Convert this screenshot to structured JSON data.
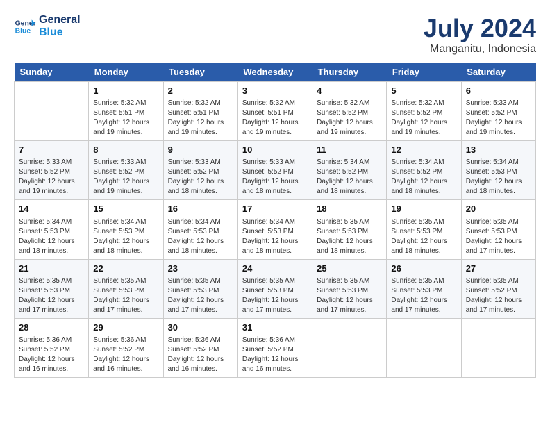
{
  "header": {
    "logo_line1": "General",
    "logo_line2": "Blue",
    "month_year": "July 2024",
    "location": "Manganitu, Indonesia"
  },
  "weekdays": [
    "Sunday",
    "Monday",
    "Tuesday",
    "Wednesday",
    "Thursday",
    "Friday",
    "Saturday"
  ],
  "weeks": [
    [
      {
        "date": "",
        "sunrise": "",
        "sunset": "",
        "daylight": ""
      },
      {
        "date": "1",
        "sunrise": "Sunrise: 5:32 AM",
        "sunset": "Sunset: 5:51 PM",
        "daylight": "Daylight: 12 hours and 19 minutes."
      },
      {
        "date": "2",
        "sunrise": "Sunrise: 5:32 AM",
        "sunset": "Sunset: 5:51 PM",
        "daylight": "Daylight: 12 hours and 19 minutes."
      },
      {
        "date": "3",
        "sunrise": "Sunrise: 5:32 AM",
        "sunset": "Sunset: 5:51 PM",
        "daylight": "Daylight: 12 hours and 19 minutes."
      },
      {
        "date": "4",
        "sunrise": "Sunrise: 5:32 AM",
        "sunset": "Sunset: 5:52 PM",
        "daylight": "Daylight: 12 hours and 19 minutes."
      },
      {
        "date": "5",
        "sunrise": "Sunrise: 5:32 AM",
        "sunset": "Sunset: 5:52 PM",
        "daylight": "Daylight: 12 hours and 19 minutes."
      },
      {
        "date": "6",
        "sunrise": "Sunrise: 5:33 AM",
        "sunset": "Sunset: 5:52 PM",
        "daylight": "Daylight: 12 hours and 19 minutes."
      }
    ],
    [
      {
        "date": "7",
        "sunrise": "Sunrise: 5:33 AM",
        "sunset": "Sunset: 5:52 PM",
        "daylight": "Daylight: 12 hours and 19 minutes."
      },
      {
        "date": "8",
        "sunrise": "Sunrise: 5:33 AM",
        "sunset": "Sunset: 5:52 PM",
        "daylight": "Daylight: 12 hours and 19 minutes."
      },
      {
        "date": "9",
        "sunrise": "Sunrise: 5:33 AM",
        "sunset": "Sunset: 5:52 PM",
        "daylight": "Daylight: 12 hours and 18 minutes."
      },
      {
        "date": "10",
        "sunrise": "Sunrise: 5:33 AM",
        "sunset": "Sunset: 5:52 PM",
        "daylight": "Daylight: 12 hours and 18 minutes."
      },
      {
        "date": "11",
        "sunrise": "Sunrise: 5:34 AM",
        "sunset": "Sunset: 5:52 PM",
        "daylight": "Daylight: 12 hours and 18 minutes."
      },
      {
        "date": "12",
        "sunrise": "Sunrise: 5:34 AM",
        "sunset": "Sunset: 5:52 PM",
        "daylight": "Daylight: 12 hours and 18 minutes."
      },
      {
        "date": "13",
        "sunrise": "Sunrise: 5:34 AM",
        "sunset": "Sunset: 5:53 PM",
        "daylight": "Daylight: 12 hours and 18 minutes."
      }
    ],
    [
      {
        "date": "14",
        "sunrise": "Sunrise: 5:34 AM",
        "sunset": "Sunset: 5:53 PM",
        "daylight": "Daylight: 12 hours and 18 minutes."
      },
      {
        "date": "15",
        "sunrise": "Sunrise: 5:34 AM",
        "sunset": "Sunset: 5:53 PM",
        "daylight": "Daylight: 12 hours and 18 minutes."
      },
      {
        "date": "16",
        "sunrise": "Sunrise: 5:34 AM",
        "sunset": "Sunset: 5:53 PM",
        "daylight": "Daylight: 12 hours and 18 minutes."
      },
      {
        "date": "17",
        "sunrise": "Sunrise: 5:34 AM",
        "sunset": "Sunset: 5:53 PM",
        "daylight": "Daylight: 12 hours and 18 minutes."
      },
      {
        "date": "18",
        "sunrise": "Sunrise: 5:35 AM",
        "sunset": "Sunset: 5:53 PM",
        "daylight": "Daylight: 12 hours and 18 minutes."
      },
      {
        "date": "19",
        "sunrise": "Sunrise: 5:35 AM",
        "sunset": "Sunset: 5:53 PM",
        "daylight": "Daylight: 12 hours and 18 minutes."
      },
      {
        "date": "20",
        "sunrise": "Sunrise: 5:35 AM",
        "sunset": "Sunset: 5:53 PM",
        "daylight": "Daylight: 12 hours and 17 minutes."
      }
    ],
    [
      {
        "date": "21",
        "sunrise": "Sunrise: 5:35 AM",
        "sunset": "Sunset: 5:53 PM",
        "daylight": "Daylight: 12 hours and 17 minutes."
      },
      {
        "date": "22",
        "sunrise": "Sunrise: 5:35 AM",
        "sunset": "Sunset: 5:53 PM",
        "daylight": "Daylight: 12 hours and 17 minutes."
      },
      {
        "date": "23",
        "sunrise": "Sunrise: 5:35 AM",
        "sunset": "Sunset: 5:53 PM",
        "daylight": "Daylight: 12 hours and 17 minutes."
      },
      {
        "date": "24",
        "sunrise": "Sunrise: 5:35 AM",
        "sunset": "Sunset: 5:53 PM",
        "daylight": "Daylight: 12 hours and 17 minutes."
      },
      {
        "date": "25",
        "sunrise": "Sunrise: 5:35 AM",
        "sunset": "Sunset: 5:53 PM",
        "daylight": "Daylight: 12 hours and 17 minutes."
      },
      {
        "date": "26",
        "sunrise": "Sunrise: 5:35 AM",
        "sunset": "Sunset: 5:53 PM",
        "daylight": "Daylight: 12 hours and 17 minutes."
      },
      {
        "date": "27",
        "sunrise": "Sunrise: 5:35 AM",
        "sunset": "Sunset: 5:52 PM",
        "daylight": "Daylight: 12 hours and 17 minutes."
      }
    ],
    [
      {
        "date": "28",
        "sunrise": "Sunrise: 5:36 AM",
        "sunset": "Sunset: 5:52 PM",
        "daylight": "Daylight: 12 hours and 16 minutes."
      },
      {
        "date": "29",
        "sunrise": "Sunrise: 5:36 AM",
        "sunset": "Sunset: 5:52 PM",
        "daylight": "Daylight: 12 hours and 16 minutes."
      },
      {
        "date": "30",
        "sunrise": "Sunrise: 5:36 AM",
        "sunset": "Sunset: 5:52 PM",
        "daylight": "Daylight: 12 hours and 16 minutes."
      },
      {
        "date": "31",
        "sunrise": "Sunrise: 5:36 AM",
        "sunset": "Sunset: 5:52 PM",
        "daylight": "Daylight: 12 hours and 16 minutes."
      },
      {
        "date": "",
        "sunrise": "",
        "sunset": "",
        "daylight": ""
      },
      {
        "date": "",
        "sunrise": "",
        "sunset": "",
        "daylight": ""
      },
      {
        "date": "",
        "sunrise": "",
        "sunset": "",
        "daylight": ""
      }
    ]
  ]
}
